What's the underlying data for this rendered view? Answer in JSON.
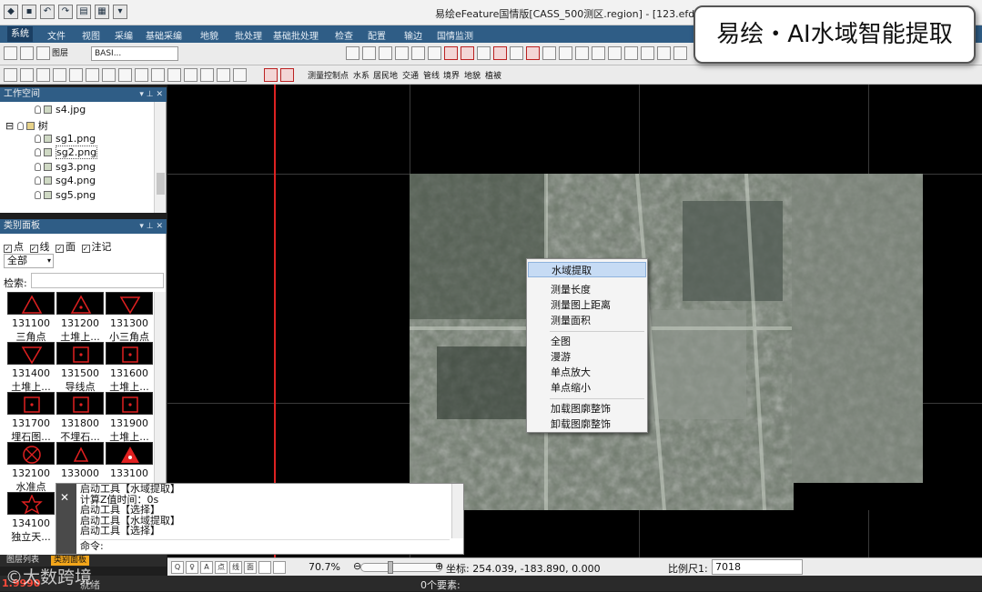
{
  "window": {
    "title": "易绘eFeature国情版[CASS_500测区.region] - [123.efdb]"
  },
  "callout": {
    "text": "易绘・AI水域智能提取"
  },
  "menu": {
    "items": [
      "系统",
      "文件",
      "视图",
      "采编",
      "基础采编",
      "地貌",
      "批处理",
      "基础批处理",
      "检查",
      "配置",
      "输边",
      "国情监测"
    ]
  },
  "toolbar1": {
    "layer_label": "图层",
    "layer_combo": "BASI..."
  },
  "toolbar2": {
    "words": [
      "测量控制点",
      "水系",
      "居民地",
      "交通",
      "管线",
      "境界",
      "地貌",
      "植被"
    ]
  },
  "workspace": {
    "title": "工作空间",
    "items": [
      {
        "label": "s4.jpg"
      },
      {
        "label": "树"
      },
      {
        "label": "sg1.png"
      },
      {
        "label": "sg2.png"
      },
      {
        "label": "sg3.png"
      },
      {
        "label": "sg4.png"
      },
      {
        "label": "sg5.png"
      }
    ]
  },
  "category": {
    "title": "类别面板",
    "filters": [
      "点",
      "线",
      "面",
      "注记"
    ],
    "select": "全部",
    "search_label": "检索:",
    "symbols": [
      {
        "code": "131100",
        "name": "三角点",
        "shape": "triangle"
      },
      {
        "code": "131200",
        "name": "土堆上...",
        "shape": "triangle-dot"
      },
      {
        "code": "131300",
        "name": "小三角点",
        "shape": "triangle-down"
      },
      {
        "code": "131400",
        "name": "土堆上...",
        "shape": "triangle-down"
      },
      {
        "code": "131500",
        "name": "导线点",
        "shape": "square-dot"
      },
      {
        "code": "131600",
        "name": "土堆上...",
        "shape": "square-dot"
      },
      {
        "code": "131700",
        "name": "埋石图...",
        "shape": "square-dot"
      },
      {
        "code": "131800",
        "name": "不埋石...",
        "shape": "square-dot"
      },
      {
        "code": "131900",
        "name": "土堆上...",
        "shape": "square-dot"
      },
      {
        "code": "132100",
        "name": "水准点",
        "shape": "circle-x"
      },
      {
        "code": "133000",
        "name": "",
        "shape": "triangle-small"
      },
      {
        "code": "133100",
        "name": "",
        "shape": "triangle-filled"
      },
      {
        "code": "134100",
        "name": "独立天...",
        "shape": "star"
      }
    ]
  },
  "context_menu": {
    "items": [
      {
        "label": "水域提取",
        "highlight": true
      },
      {
        "label": "测量长度"
      },
      {
        "label": "测量图上距离"
      },
      {
        "label": "测量面积"
      },
      {
        "label": "全图"
      },
      {
        "label": "漫游"
      },
      {
        "label": "单点放大"
      },
      {
        "label": "单点缩小"
      },
      {
        "label": "加载图廓整饰"
      },
      {
        "label": "卸载图廓整饰"
      }
    ]
  },
  "command": {
    "lines": [
      "启动工具【水域提取】",
      "计算Z值时间：0s",
      "启动工具【选择】",
      "启动工具【水域提取】",
      "启动工具【选择】"
    ],
    "prompt": "命令:"
  },
  "panel_tabs": [
    "图层列表",
    "类别面板"
  ],
  "status": {
    "zoom": "70.7%",
    "coords": "坐标: 254.039, -183.890, 0.000",
    "scale_label": "比例尺1:",
    "scale_value": "7018",
    "icons": [
      "Q",
      "♀",
      "A",
      "点",
      "线",
      "面",
      "",
      ""
    ]
  },
  "footer": {
    "count": "0个要素:",
    "left": "1.9990",
    "mid": "就绪"
  },
  "watermark": {
    "text": "©大数跨境"
  },
  "colors": {
    "menu_bg": "#2f5d86",
    "highlight": "#c6dbf4",
    "red_line": "#dd2222",
    "active_tab": "#f2a51a"
  }
}
